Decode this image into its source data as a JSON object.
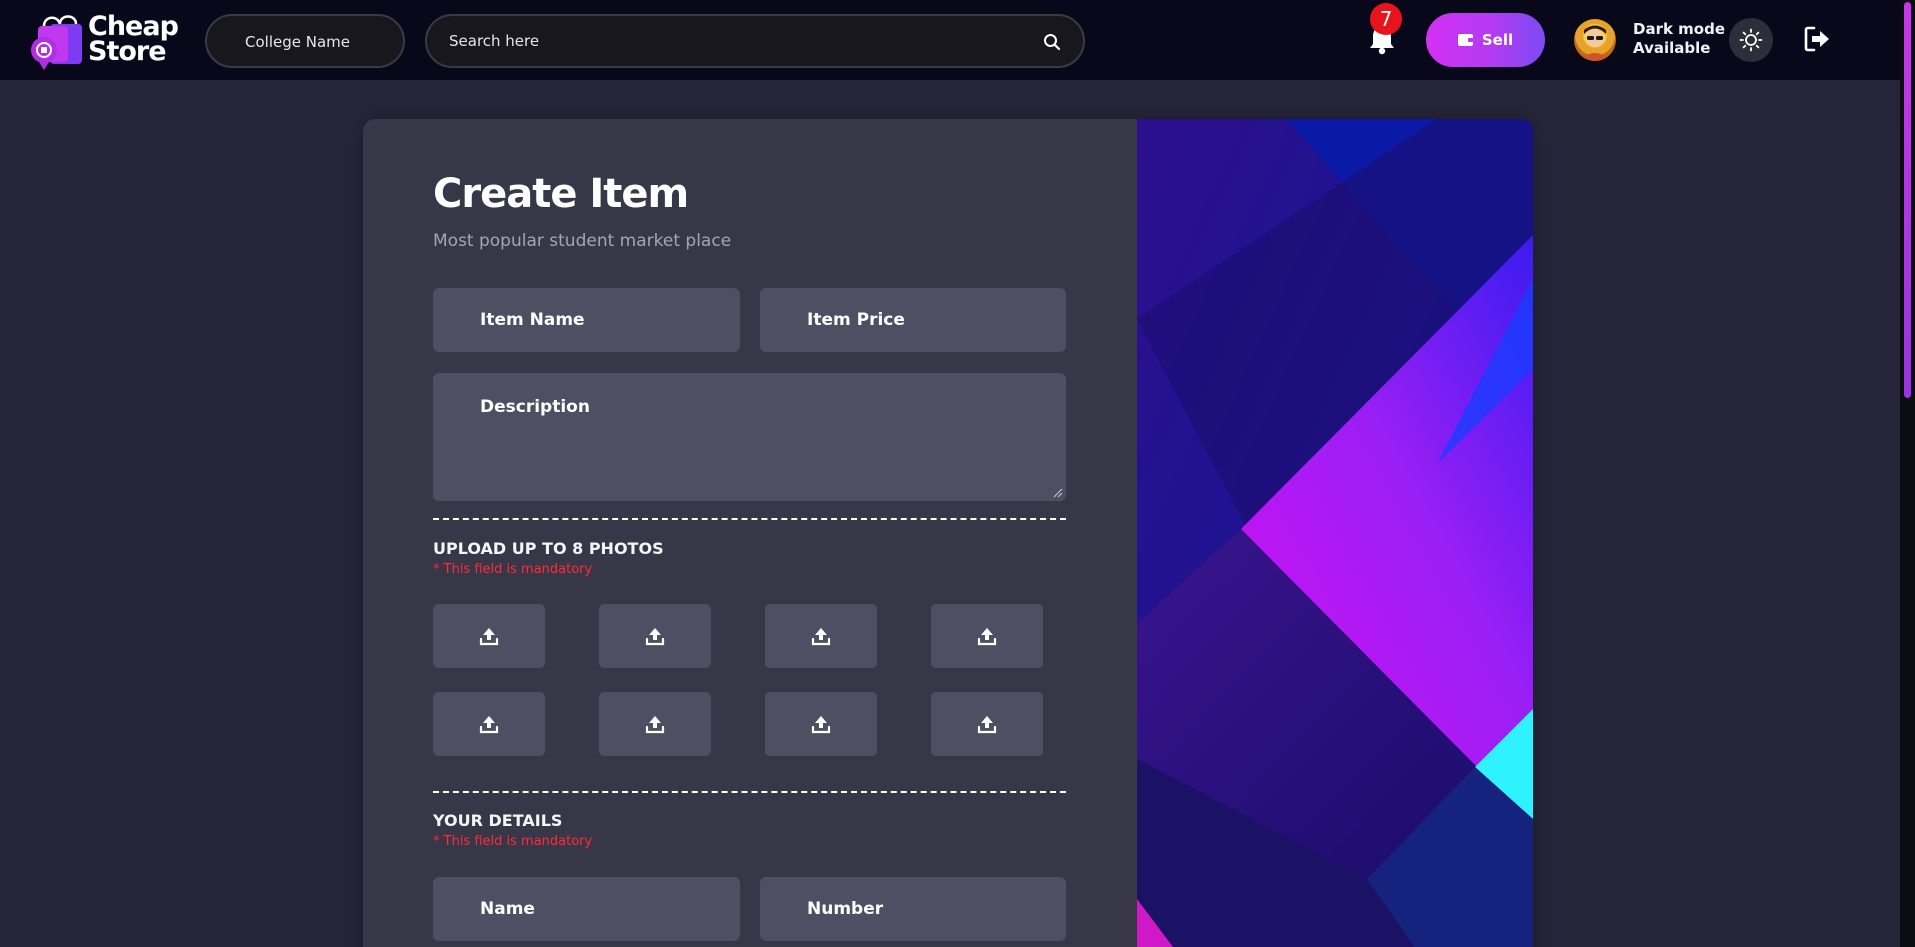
{
  "header": {
    "logo_line1": "Cheap",
    "logo_line2": "Store",
    "college_label": "College Name",
    "search_placeholder": "Search here",
    "notification_count": "7",
    "sell_label": "Sell",
    "darkmode_line1": "Dark mode",
    "darkmode_line2": "Available"
  },
  "form": {
    "title": "Create Item",
    "subtitle": "Most popular student market place",
    "item_name_placeholder": "Item Name",
    "item_price_placeholder": "Item Price",
    "description_placeholder": "Description",
    "photos_heading": "UPLOAD UP TO 8 PHOTOS",
    "photos_mandatory": "* This field is mandatory",
    "upload_slots": 8,
    "details_heading": "YOUR DETAILS",
    "details_mandatory": "* This field is mandatory",
    "name_placeholder": "Name",
    "number_placeholder": "Number"
  },
  "colors": {
    "background": "#26253a",
    "header": "#08081a",
    "card": "#383747",
    "field": "#4f4e62",
    "accent": "#d331f2",
    "mandatory": "#ff2a3a",
    "badge": "#e8141c"
  },
  "icons": [
    "shopping-bag-logo",
    "search-icon",
    "bell-icon",
    "wallet-icon",
    "sun-icon",
    "logout-icon",
    "upload-icon"
  ]
}
